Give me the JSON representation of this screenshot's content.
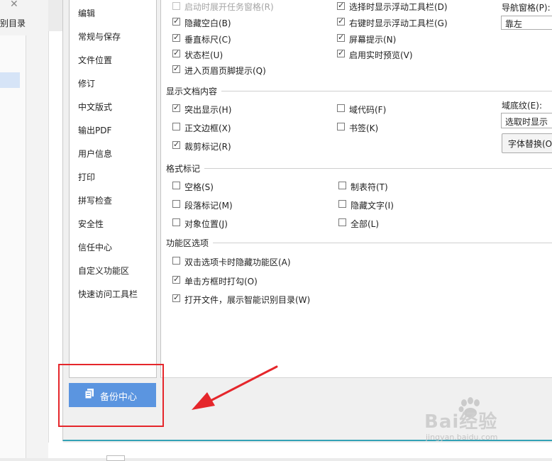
{
  "background": {
    "sidebar_title": "别目录",
    "close_icon": "close-icon"
  },
  "nav": {
    "items": [
      "编辑",
      "常规与保存",
      "文件位置",
      "修订",
      "中文版式",
      "输出PDF",
      "用户信息",
      "打印",
      "拼写检查",
      "安全性",
      "信任中心",
      "自定义功能区",
      "快速访问工具栏"
    ]
  },
  "backup": {
    "label": "备份中心",
    "icon": "backup-icon"
  },
  "top_options": {
    "left": [
      {
        "label": "启动时展开任务窗格(R)",
        "checked": false,
        "disabled": true
      },
      {
        "label": "隐藏空白(B)",
        "checked": true
      },
      {
        "label": "垂直标尺(C)",
        "checked": true
      },
      {
        "label": "状态栏(U)",
        "checked": true
      },
      {
        "label": "进入页眉页脚提示(Q)",
        "checked": true
      }
    ],
    "right": [
      {
        "label": "选择时显示浮动工具栏(D)",
        "checked": true
      },
      {
        "label": "右键时显示浮动工具栏(G)",
        "checked": true
      },
      {
        "label": "屏幕提示(N)",
        "checked": true
      },
      {
        "label": "启用实时预览(V)",
        "checked": true
      }
    ]
  },
  "nav_pane": {
    "label": "导航窗格(P):",
    "value": "靠左"
  },
  "display_content": {
    "title": "显示文档内容",
    "left": [
      {
        "label": "突出显示(H)",
        "checked": true
      },
      {
        "label": "正文边框(X)",
        "checked": false
      },
      {
        "label": "裁剪标记(R)",
        "checked": true
      }
    ],
    "right": [
      {
        "label": "域代码(F)",
        "checked": false
      },
      {
        "label": "书签(K)",
        "checked": false
      }
    ],
    "field_shading_label": "域底纹(E):",
    "field_shading_value": "选取时显示",
    "font_replace_button": "字体替换(O"
  },
  "format_marks": {
    "title": "格式标记",
    "left": [
      {
        "label": "空格(S)",
        "checked": false
      },
      {
        "label": "段落标记(M)",
        "checked": false
      },
      {
        "label": "对象位置(J)",
        "checked": false
      }
    ],
    "right": [
      {
        "label": "制表符(T)",
        "checked": false
      },
      {
        "label": "隐藏文字(I)",
        "checked": false
      },
      {
        "label": "全部(L)",
        "checked": false
      }
    ]
  },
  "ribbon_options": {
    "title": "功能区选项",
    "items": [
      {
        "label": "双击选项卡时隐藏功能区(A)",
        "checked": false
      },
      {
        "label": "单击方框时打勾(O)",
        "checked": true
      },
      {
        "label": "打开文件，展示智能识别目录(W)",
        "checked": true
      }
    ]
  },
  "watermark": {
    "brand": "Bai经验",
    "sub": "jingyan.baidu.com"
  },
  "colors": {
    "accent_button": "#5b95e0",
    "highlight_box": "#e5262b",
    "arrow": "#e5262b"
  }
}
